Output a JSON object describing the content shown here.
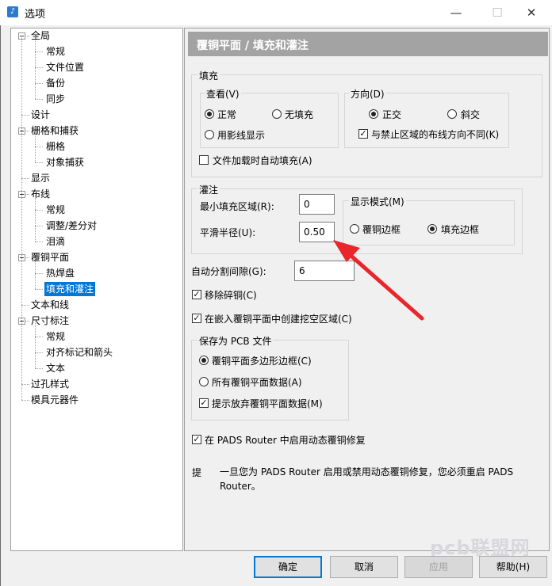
{
  "window": {
    "title": "选项",
    "icon": "app-icon",
    "controls": {
      "minimize": "—",
      "maximize": "☐",
      "close": "✕"
    }
  },
  "tree": {
    "items": [
      {
        "label": "全局",
        "level": 0
      },
      {
        "label": "常规",
        "level": 1
      },
      {
        "label": "文件位置",
        "level": 1
      },
      {
        "label": "备份",
        "level": 1
      },
      {
        "label": "同步",
        "level": 1
      },
      {
        "label": "设计",
        "level": 0
      },
      {
        "label": "栅格和捕获",
        "level": 0
      },
      {
        "label": "栅格",
        "level": 1
      },
      {
        "label": "对象捕获",
        "level": 1
      },
      {
        "label": "显示",
        "level": 0
      },
      {
        "label": "布线",
        "level": 0
      },
      {
        "label": "常规",
        "level": 1
      },
      {
        "label": "调整/差分对",
        "level": 1
      },
      {
        "label": "泪滴",
        "level": 1
      },
      {
        "label": "覆铜平面",
        "level": 0
      },
      {
        "label": "热焊盘",
        "level": 1
      },
      {
        "label": "填充和灌注",
        "level": 1,
        "selected": true
      },
      {
        "label": "文本和线",
        "level": 0
      },
      {
        "label": "尺寸标注",
        "level": 0
      },
      {
        "label": "常规",
        "level": 1
      },
      {
        "label": "对齐标记和箭头",
        "level": 1
      },
      {
        "label": "文本",
        "level": 1
      },
      {
        "label": "过孔样式",
        "level": 0
      },
      {
        "label": "模具元器件",
        "level": 0
      }
    ]
  },
  "panel": {
    "title": "覆铜平面 / 填充和灌注",
    "fill": {
      "group_label": "填充",
      "view": {
        "label": "查看(V)",
        "options": [
          "正常",
          "无填充",
          "用影线显示"
        ],
        "selected": "正常"
      },
      "direction": {
        "label": "方向(D)",
        "options": [
          "正交",
          "斜交"
        ],
        "selected": "正交",
        "check_label": "与禁止区域的布线方向不同(K)",
        "checked": true
      },
      "autofill_label": "文件加载时自动填充(A)",
      "autofill_checked": false
    },
    "flood": {
      "group_label": "灌注",
      "min_area_label": "最小填充区域(R):",
      "min_area_value": "0",
      "smooth_radius_label": "平滑半径(U):",
      "smooth_radius_value": "0.50",
      "display_mode": {
        "label": "显示模式(M)",
        "options": [
          "覆铜边框",
          "填充边框"
        ],
        "selected": "填充边框"
      }
    },
    "auto_split_label": "自动分割间隙(G):",
    "auto_split_value": "6",
    "remove_isolated_label": "移除碎铜(C)",
    "remove_isolated_checked": true,
    "create_cutout_label": "在嵌入覆铜平面中创建挖空区域(C)",
    "create_cutout_checked": true,
    "save_pcb": {
      "group_label": "保存为 PCB 文件",
      "options": [
        "覆铜平面多边形边框(C)",
        "所有覆铜平面数据(A)"
      ],
      "selected": "覆铜平面多边形边框(C)",
      "prompt_label": "提示放弃覆铜平面数据(M)",
      "prompt_checked": true
    },
    "router_label": "在 PADS Router 中启用动态覆铜修复",
    "router_checked": true,
    "tip": {
      "prefix": "提",
      "text": "一旦您为 PADS Router 启用或禁用动态覆铜修复，您必须重启 PADS Router。"
    }
  },
  "buttons": {
    "ok": "确定",
    "cancel": "取消",
    "apply": "应用",
    "help": "帮助(H)"
  },
  "watermark": "pcb联盟网",
  "colors": {
    "selection": "#0078d7",
    "header": "#a3a3a3",
    "arrow": "#e8262c"
  }
}
